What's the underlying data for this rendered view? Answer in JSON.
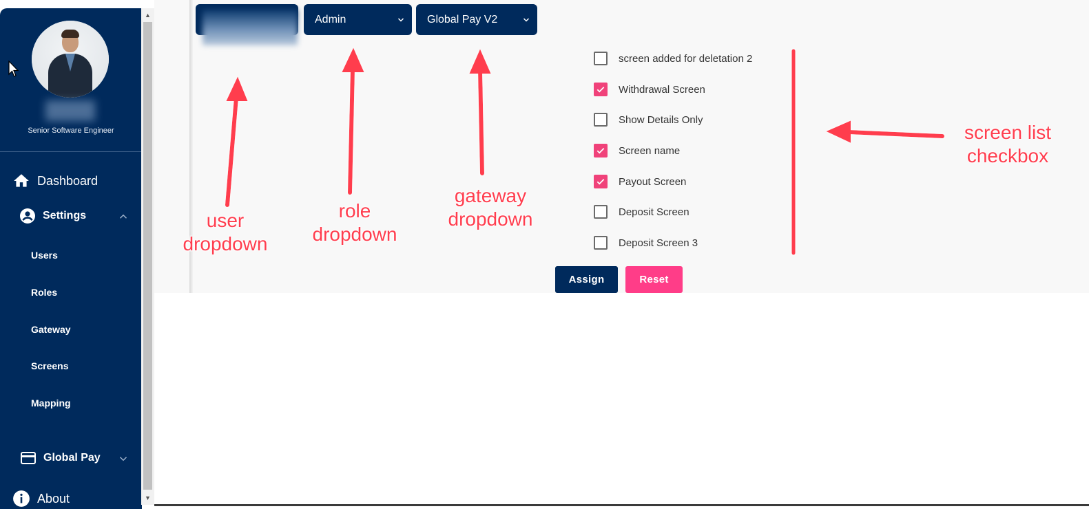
{
  "sidebar": {
    "job_title": "Senior Software Engineer",
    "dashboard_label": "Dashboard",
    "settings_label": "Settings",
    "sub_items": [
      "Users",
      "Roles",
      "Gateway",
      "Screens",
      "Mapping"
    ],
    "global_pay_label": "Global Pay",
    "about_label": "About",
    "background_color": "#002a5c"
  },
  "toolbar": {
    "user_dropdown_value": "",
    "role_dropdown_value": "Admin",
    "gateway_dropdown_value": "Global Pay V2"
  },
  "screens": [
    {
      "label": "screen added for deletation 2",
      "checked": false
    },
    {
      "label": "Withdrawal Screen",
      "checked": true
    },
    {
      "label": "Show Details Only",
      "checked": false
    },
    {
      "label": "Screen name",
      "checked": true
    },
    {
      "label": "Payout Screen",
      "checked": true
    },
    {
      "label": "Deposit Screen",
      "checked": false
    },
    {
      "label": "Deposit Screen 3",
      "checked": false
    }
  ],
  "actions": {
    "assign_label": "Assign",
    "reset_label": "Reset",
    "assign_color": "#002a5c",
    "reset_color": "#ff3d88"
  },
  "annotations": {
    "user": "user\ndropdown",
    "role": "role\ndropdown",
    "gateway": "gateway\ndropdown",
    "screen": "screen list\ncheckbox",
    "color": "#ff3d4e"
  }
}
